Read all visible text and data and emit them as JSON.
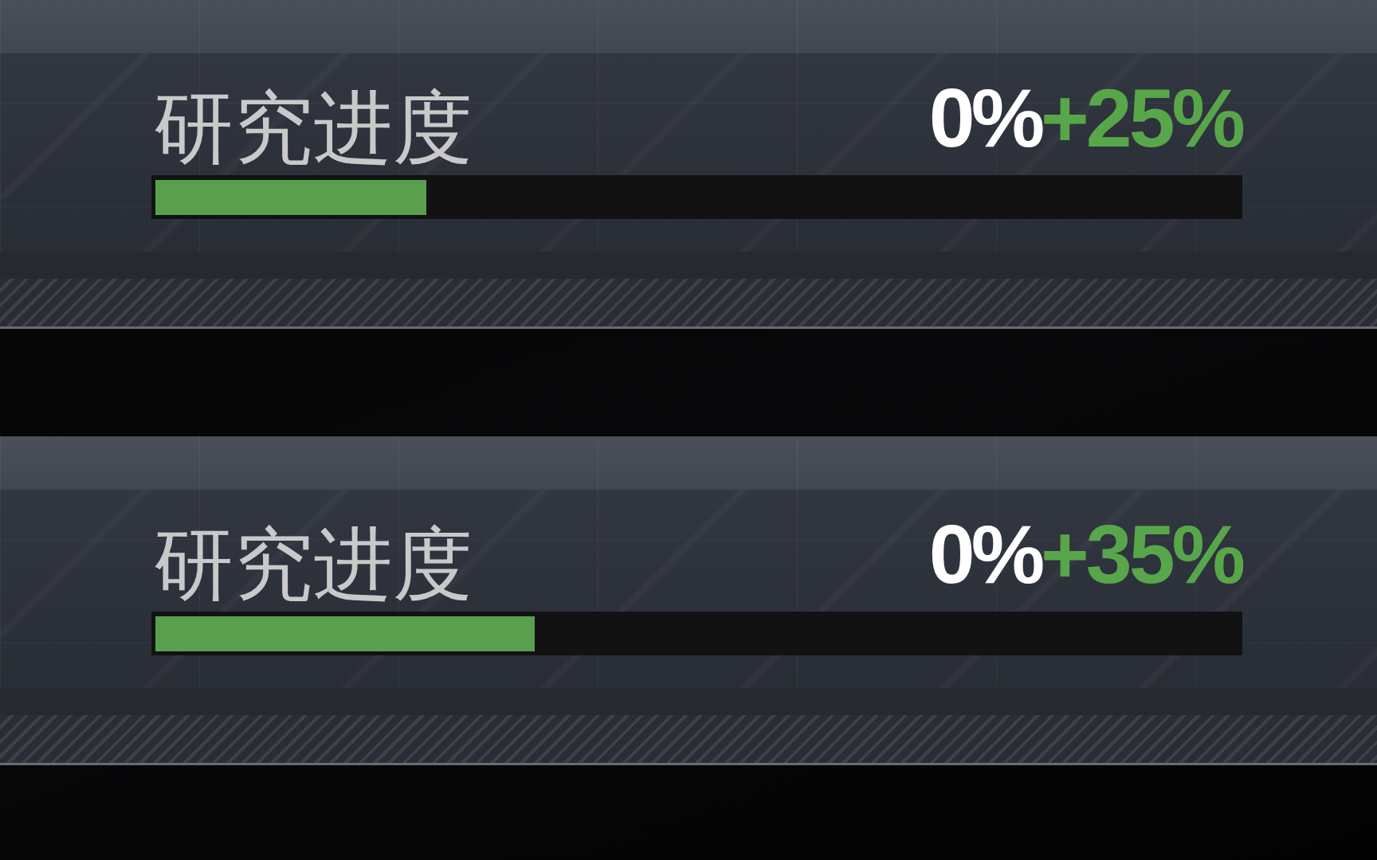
{
  "panels": [
    {
      "title": "研究进度",
      "current": "0%",
      "bonus": "+25%",
      "level": 0.25
    },
    {
      "title": "研究进度",
      "current": "0%",
      "bonus": "+35%",
      "level": 0.35
    }
  ]
}
